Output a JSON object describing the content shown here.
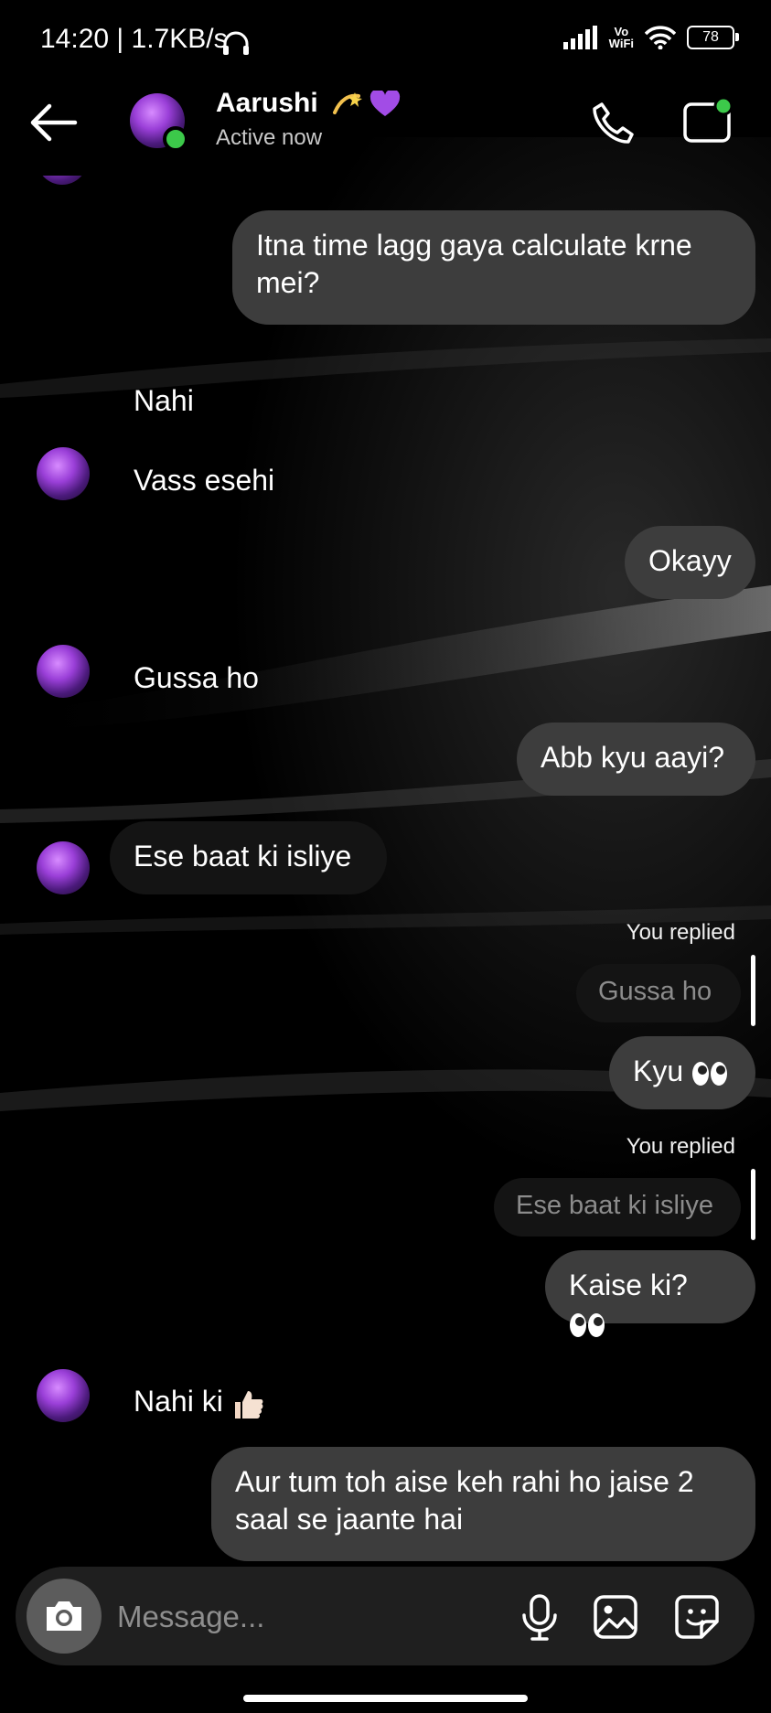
{
  "status_bar": {
    "time": "14:20 | 1.7KB/s",
    "vowifi_top": "Vo",
    "vowifi_bottom": "WiFi",
    "battery": "78"
  },
  "header": {
    "name": "Aarushi",
    "status": "Active now"
  },
  "messages": {
    "m1": "Itna time lagg gaya calculate krne mei?",
    "m2": "Nahi",
    "m3": "Vass esehi",
    "m4": "Okayy",
    "m5": "Gussa ho",
    "m6": "Abb kyu aayi?",
    "m7": "Ese baat ki isliye",
    "r1_label": "You replied",
    "r1_quote": "Gussa ho",
    "m8": "Kyu",
    "r2_label": "You replied",
    "r2_quote": "Ese baat ki isliye",
    "m9": "Kaise ki?",
    "m10": "Nahi ki",
    "m11": "Aur tum toh aise keh rahi ho jaise 2 saal se jaante hai"
  },
  "composer": {
    "placeholder": "Message..."
  },
  "colors": {
    "sent_bubble": "#3d3d3d",
    "received_bubble": "#141414",
    "online": "#3cc94a",
    "background": "#000000"
  },
  "icons": {
    "back": "arrow-left-icon",
    "call": "phone-icon",
    "video": "video-call-icon",
    "camera": "camera-icon",
    "mic": "microphone-icon",
    "gallery": "image-icon",
    "sticker": "sticker-icon"
  }
}
